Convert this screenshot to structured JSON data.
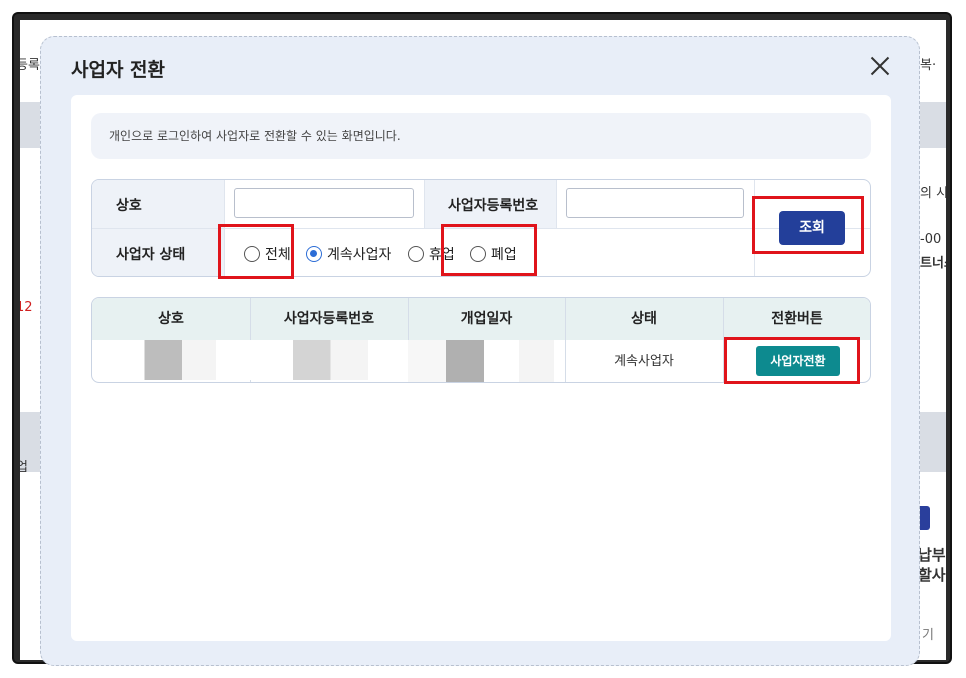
{
  "background": {
    "fragments": [
      "등록",
      "복·",
      "의 시",
      "-00",
      "트너스",
      "12",
      "업",
      "납부",
      "할사",
      "기"
    ]
  },
  "modal": {
    "title": "사업자 전환",
    "description": "개인으로 로그인하여 사업자로 전환할 수 있는 화면입니다."
  },
  "search": {
    "name_label": "상호",
    "name_value": "",
    "regno_label": "사업자등록번호",
    "regno_value": "",
    "status_label": "사업자 상태",
    "status_options": [
      {
        "label": "전체",
        "selected": false
      },
      {
        "label": "계속사업자",
        "selected": true
      },
      {
        "label": "휴업",
        "selected": false
      },
      {
        "label": "폐업",
        "selected": false
      }
    ],
    "search_button": "조회"
  },
  "table": {
    "headers": [
      "상호",
      "사업자등록번호",
      "개업일자",
      "상태",
      "전환버튼"
    ],
    "rows": [
      {
        "name": "",
        "regno": "",
        "open_date": "",
        "status": "계속사업자",
        "action": "사업자전환"
      }
    ]
  },
  "colors": {
    "primary_button": "#233f9a",
    "switch_button": "#0d8a8f",
    "highlight": "#e0141b"
  }
}
